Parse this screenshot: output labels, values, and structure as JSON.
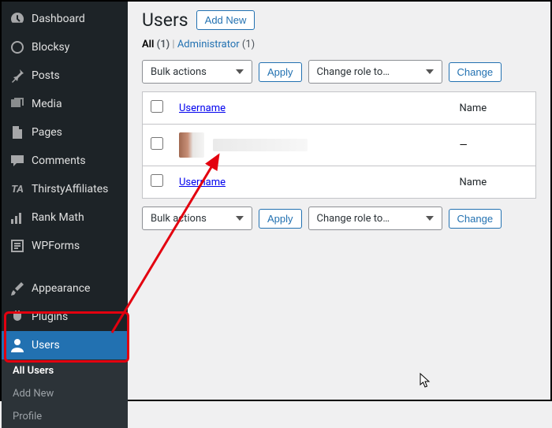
{
  "sidebar": {
    "items": [
      {
        "label": "Dashboard"
      },
      {
        "label": "Blocksy"
      },
      {
        "label": "Posts"
      },
      {
        "label": "Media"
      },
      {
        "label": "Pages"
      },
      {
        "label": "Comments"
      },
      {
        "label": "ThirstyAffiliates"
      },
      {
        "label": "Rank Math"
      },
      {
        "label": "WPForms"
      },
      {
        "label": "Appearance"
      },
      {
        "label": "Plugins"
      },
      {
        "label": "Users"
      }
    ],
    "submenu": [
      {
        "label": "All Users"
      },
      {
        "label": "Add New"
      },
      {
        "label": "Profile"
      }
    ]
  },
  "page": {
    "title": "Users",
    "add_new": "Add New"
  },
  "filters": {
    "all_label": "All",
    "all_count": "(1)",
    "sep": " | ",
    "admin_label": "Administrator",
    "admin_count": "(1)"
  },
  "actions": {
    "bulk": "Bulk actions",
    "apply": "Apply",
    "change_role": "Change role to…",
    "change": "Change"
  },
  "table": {
    "col_username": "Username",
    "col_name": "Name",
    "row_name": "—"
  }
}
